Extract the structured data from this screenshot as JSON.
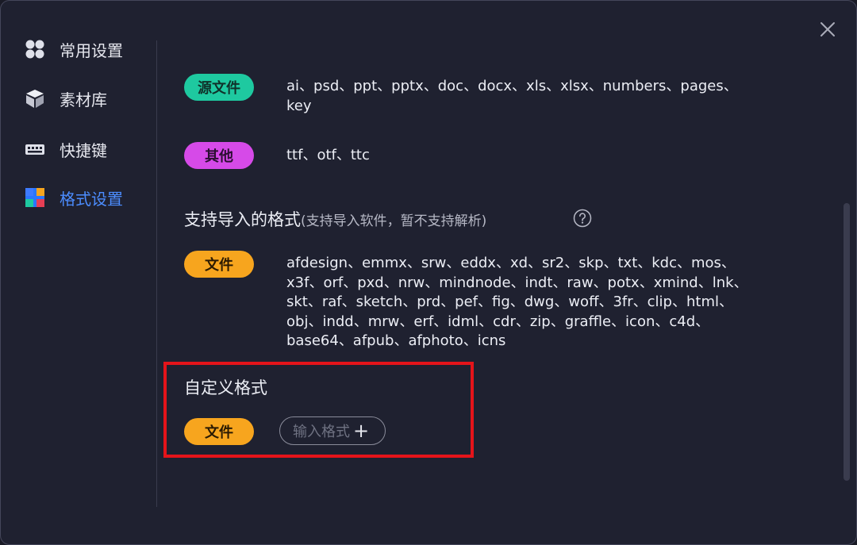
{
  "sidebar": {
    "items": [
      {
        "label": "常用设置",
        "icon": "grid-icon"
      },
      {
        "label": "素材库",
        "icon": "cube-icon"
      },
      {
        "label": "快捷键",
        "icon": "keyboard-icon"
      },
      {
        "label": "格式设置",
        "icon": "format-icon",
        "active": true
      }
    ]
  },
  "colors": {
    "accent": "#4c8dff",
    "source_badge": "#1ec9a0",
    "other_badge": "#d64ae8",
    "file_badge": "#f7a51e",
    "highlight": "#e4141a"
  },
  "content": {
    "source": {
      "badge": "源文件",
      "formats": "ai、psd、ppt、pptx、doc、docx、xls、xlsx、numbers、pages、key"
    },
    "other": {
      "badge": "其他",
      "formats": "ttf、otf、ttc"
    },
    "import_section": {
      "title": "支持导入的格式",
      "subtitle": "(支持导入软件，暂不支持解析)",
      "badge": "文件",
      "formats": "afdesign、emmx、srw、eddx、xd、sr2、skp、txt、kdc、mos、x3f、orf、pxd、nrw、mindnode、indt、raw、potx、xmind、lnk、skt、raf、sketch、prd、pef、fig、dwg、woff、3fr、clip、html、obj、indd、mrw、erf、idml、cdr、zip、graffle、icon、c4d、base64、afpub、afphoto、icns"
    },
    "custom_section": {
      "title": "自定义格式",
      "badge": "文件",
      "input_placeholder": "输入格式",
      "input_plus": "+"
    }
  }
}
